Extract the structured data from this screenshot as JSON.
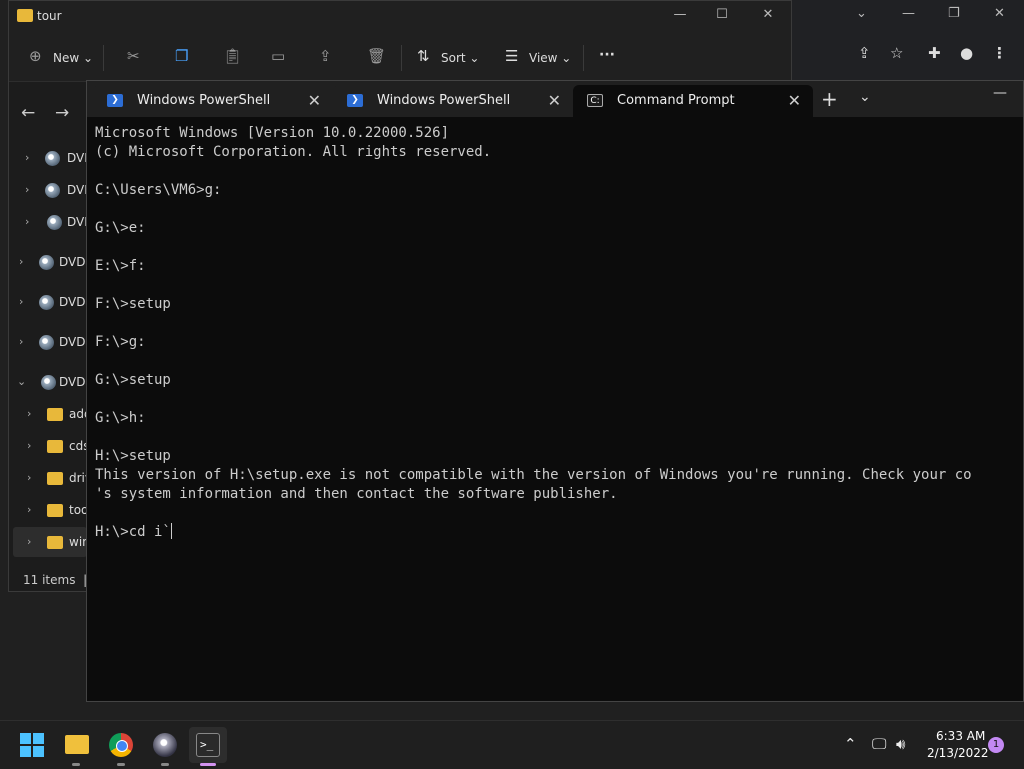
{
  "explorer": {
    "title": "tour",
    "toolbar": {
      "new_label": "New",
      "sort_label": "Sort",
      "view_label": "View",
      "more_label": "···"
    },
    "tree": [
      {
        "label": "DVD",
        "expanded": false
      },
      {
        "label": "DVD",
        "expanded": false
      },
      {
        "label": "DVD",
        "expanded": false
      },
      {
        "label": "DVD",
        "expanded": false
      },
      {
        "label": "DVD",
        "expanded": false
      },
      {
        "label": "DVD",
        "expanded": false
      },
      {
        "label": "DVD",
        "expanded": true
      },
      {
        "label": "add",
        "type": "folder"
      },
      {
        "label": "cds",
        "type": "folder"
      },
      {
        "label": "driv",
        "type": "folder"
      },
      {
        "label": "tool",
        "type": "folder"
      },
      {
        "label": "win",
        "type": "folder",
        "selected": true
      }
    ],
    "status": "11 items"
  },
  "terminal": {
    "tabs": [
      {
        "label": "Windows PowerShell",
        "active": false
      },
      {
        "label": "Windows PowerShell",
        "active": false
      },
      {
        "label": "Command Prompt",
        "active": true
      }
    ],
    "lines": [
      "Microsoft Windows [Version 10.0.22000.526]",
      "(c) Microsoft Corporation. All rights reserved.",
      "",
      "C:\\Users\\VM6>g:",
      "",
      "G:\\>e:",
      "",
      "E:\\>f:",
      "",
      "F:\\>setup",
      "",
      "F:\\>g:",
      "",
      "G:\\>setup",
      "",
      "G:\\>h:",
      "",
      "H:\\>setup",
      "This version of H:\\setup.exe is not compatible with the version of Windows you're running. Check your co",
      "'s system information and then contact the software publisher.",
      "",
      "H:\\>cd i`"
    ]
  },
  "taskbar": {
    "time": "6:33 AM",
    "date": "2/13/2022",
    "notification_count": "1"
  },
  "colors": {
    "taskbar_active_indicator": "#d393f0",
    "start_blue": "#4cc2ff",
    "folder_yellow": "#e8b83a",
    "console_text": "#cccccc"
  }
}
